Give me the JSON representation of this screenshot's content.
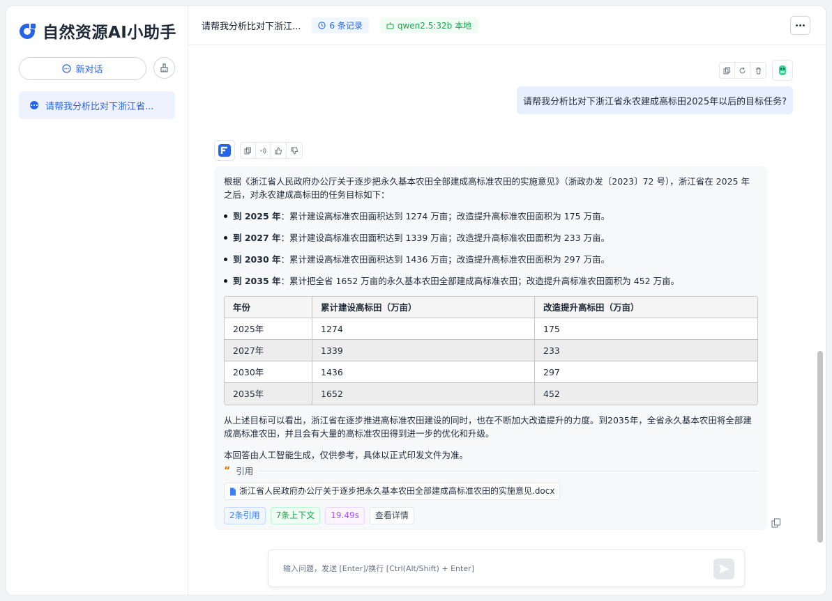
{
  "app": {
    "title": "自然资源AI小助手",
    "accent": "#2563eb"
  },
  "sidebar": {
    "new_chat_label": "新对话",
    "conversations": [
      {
        "label": "请帮我分析比对下浙江省..."
      }
    ]
  },
  "header": {
    "title": "请帮我分析比对下浙江...",
    "record_tag": "6 条记录",
    "model_tag": "qwen2.5:32b 本地"
  },
  "chat": {
    "user_message": "请帮我分析比对下浙江省永农建成高标田2025年以后的目标任务?",
    "bot": {
      "intro": "根据《浙江省人民政府办公厅关于逐步把永久基本农田全部建成高标准农田的实施意见》（浙政办发〔2023〕72 号），浙江省在 2025 年之后，对永农建成高标田的任务目标如下：",
      "bullets": [
        {
          "strong": "到 2025 年",
          "text": "：累计建设高标准农田面积达到 1274 万亩；改造提升高标准农田面积为 175 万亩。"
        },
        {
          "strong": "到 2027 年",
          "text": "：累计建设高标准农田面积达到 1339 万亩；改造提升高标准农田面积为 233 万亩。"
        },
        {
          "strong": "到 2030 年",
          "text": "：累计建设高标准农田面积达到 1436 万亩；改造提升高标准农田面积为 297 万亩。"
        },
        {
          "strong": "到 2035 年",
          "text": "：累计把全省 1652 万亩的永久基本农田全部建成高标准农田；改造提升高标准农田面积为 452 万亩。"
        }
      ],
      "table": {
        "headers": [
          "年份",
          "累计建设高标田（万亩）",
          "改造提升高标田（万亩）"
        ],
        "rows": [
          [
            "2025年",
            "1274",
            "175"
          ],
          [
            "2027年",
            "1339",
            "233"
          ],
          [
            "2030年",
            "1436",
            "297"
          ],
          [
            "2035年",
            "1652",
            "452"
          ]
        ]
      },
      "summary": "从上述目标可以看出，浙江省在逐步推进高标准农田建设的同时，也在不断加大改造提升的力度。到2035年，全省永久基本农田将全部建成高标准农田，并且会有大量的高标准农田得到进一步的优化和升级。",
      "disclaimer": "本回答由人工智能生成，仅供参考，具体以正式印发文件为准。",
      "citation_label": "引用",
      "citation_file": "浙江省人民政府办公厅关于逐步把永久基本农田全部建成高标准农田的实施意见.docx",
      "chips": {
        "refs": "2条引用",
        "context": "7条上下文",
        "time": "19.49s",
        "detail": "查看详情"
      }
    }
  },
  "input": {
    "placeholder": "输入问题，发送 [Enter]/换行 [Ctrl(Alt/Shift) + Enter]"
  }
}
